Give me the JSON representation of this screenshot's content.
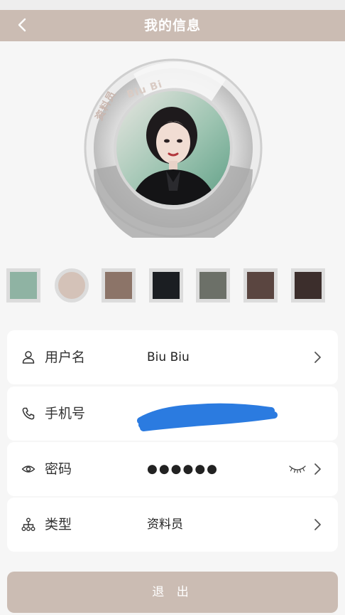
{
  "header": {
    "title": "我的信息",
    "back_icon": "chevron-left-icon"
  },
  "avatar": {
    "ring_text_cn": "资料员",
    "ring_text_en": "Biu Bi"
  },
  "swatches": [
    {
      "color": "#8fb3a3",
      "shape": "square"
    },
    {
      "color": "#d4c2b8",
      "shape": "circle"
    },
    {
      "color": "#8c7468",
      "shape": "square"
    },
    {
      "color": "#1b1e22",
      "shape": "square"
    },
    {
      "color": "#6c7068",
      "shape": "square"
    },
    {
      "color": "#5a4540",
      "shape": "square"
    },
    {
      "color": "#3c2e2c",
      "shape": "square"
    }
  ],
  "rows": [
    {
      "icon": "user-icon",
      "label": "用户名",
      "value": "Biu Biu"
    },
    {
      "icon": "phone-icon",
      "label": "手机号",
      "value": ""
    },
    {
      "icon": "eye-icon",
      "label": "密码",
      "value": "●●●●●●",
      "trailing_icon": "eye-closed-icon"
    },
    {
      "icon": "org-icon",
      "label": "类型",
      "value": "资料员"
    }
  ],
  "logout_label": "退 出",
  "colors": {
    "accent": "#cbbcb3",
    "redaction": "#2b7be0"
  }
}
